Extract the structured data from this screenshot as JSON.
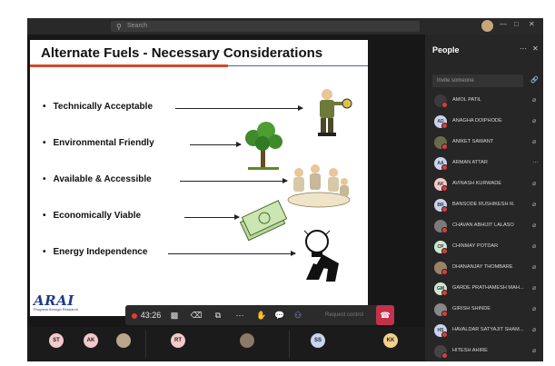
{
  "topbar": {
    "search_placeholder": "Search",
    "window_controls": [
      "more-icon",
      "minimize-icon",
      "maximize-icon",
      "close-icon"
    ]
  },
  "slide": {
    "title": "Alternate Fuels - Necessary Considerations",
    "bullets": [
      {
        "label": "Technically Acceptable",
        "art": "engineer-clipart"
      },
      {
        "label": "Environmental Friendly",
        "art": "tree-clipart"
      },
      {
        "label": "Available & Accessible",
        "art": "meeting-clipart"
      },
      {
        "label": "Economically Viable",
        "art": "money-clipart"
      },
      {
        "label": "Energy Independence",
        "art": "lightbulb-clipart"
      }
    ],
    "logo": {
      "text": "ARAI",
      "tagline": "Progress through Research"
    }
  },
  "toolbar": {
    "timer": "43:26",
    "request_label": "Request control",
    "colors": {
      "bar": "#2b2b2b",
      "leave": "#c4314b",
      "rec": "#e03b3b"
    }
  },
  "people": {
    "title": "People",
    "invite_placeholder": "Invite someone",
    "participants": [
      {
        "initials": "",
        "name": "AMOL PATIL",
        "color": "#3b3b3b"
      },
      {
        "initials": "AD",
        "name": "ANAGHA DOIPHODE",
        "color": "#c9d4ef"
      },
      {
        "initials": "",
        "name": "ANIKET SAWANT",
        "color": "#6b6b4a"
      },
      {
        "initials": "AA",
        "name": "ARMAN ATTAR",
        "color": "#c9d4ef"
      },
      {
        "initials": "AK",
        "name": "AVINASH KURWADE",
        "color": "#f3c9c9"
      },
      {
        "initials": "BR",
        "name": "BANSODE RUSHIKESH R.",
        "color": "#c9d4ef"
      },
      {
        "initials": "",
        "name": "CHAVAN ABHIJIT LALASO",
        "color": "#7a7a7a"
      },
      {
        "initials": "CP",
        "name": "CHINMAY POTDAR",
        "color": "#cfe6cf"
      },
      {
        "initials": "",
        "name": "DHANANJAY THOMBARE",
        "color": "#9a8266"
      },
      {
        "initials": "GM",
        "name": "GARDE PRATHAMESH MAH...",
        "color": "#cfe6cf"
      },
      {
        "initials": "",
        "name": "GIRISH SHINDE",
        "color": "#888888"
      },
      {
        "initials": "HS",
        "name": "HAVALDAR SATYAJIT SHAM...",
        "color": "#c9d4ef"
      },
      {
        "initials": "",
        "name": "HITESH AHIRE",
        "color": "#444444"
      }
    ]
  },
  "gallery": {
    "tiles": [
      {
        "initials": "ST",
        "color": "#f3c9c9"
      },
      {
        "initials": "AK",
        "color": "#f3c9c9"
      },
      {
        "initials": "",
        "color": "#b8a58a"
      },
      {
        "initials": "RT",
        "color": "#f3c9c9"
      },
      {
        "initials": "",
        "color": "#8a7a66"
      },
      {
        "initials": "SS",
        "color": "#c9d4ef"
      },
      {
        "initials": "KK",
        "color": "#f2d28a"
      }
    ]
  }
}
